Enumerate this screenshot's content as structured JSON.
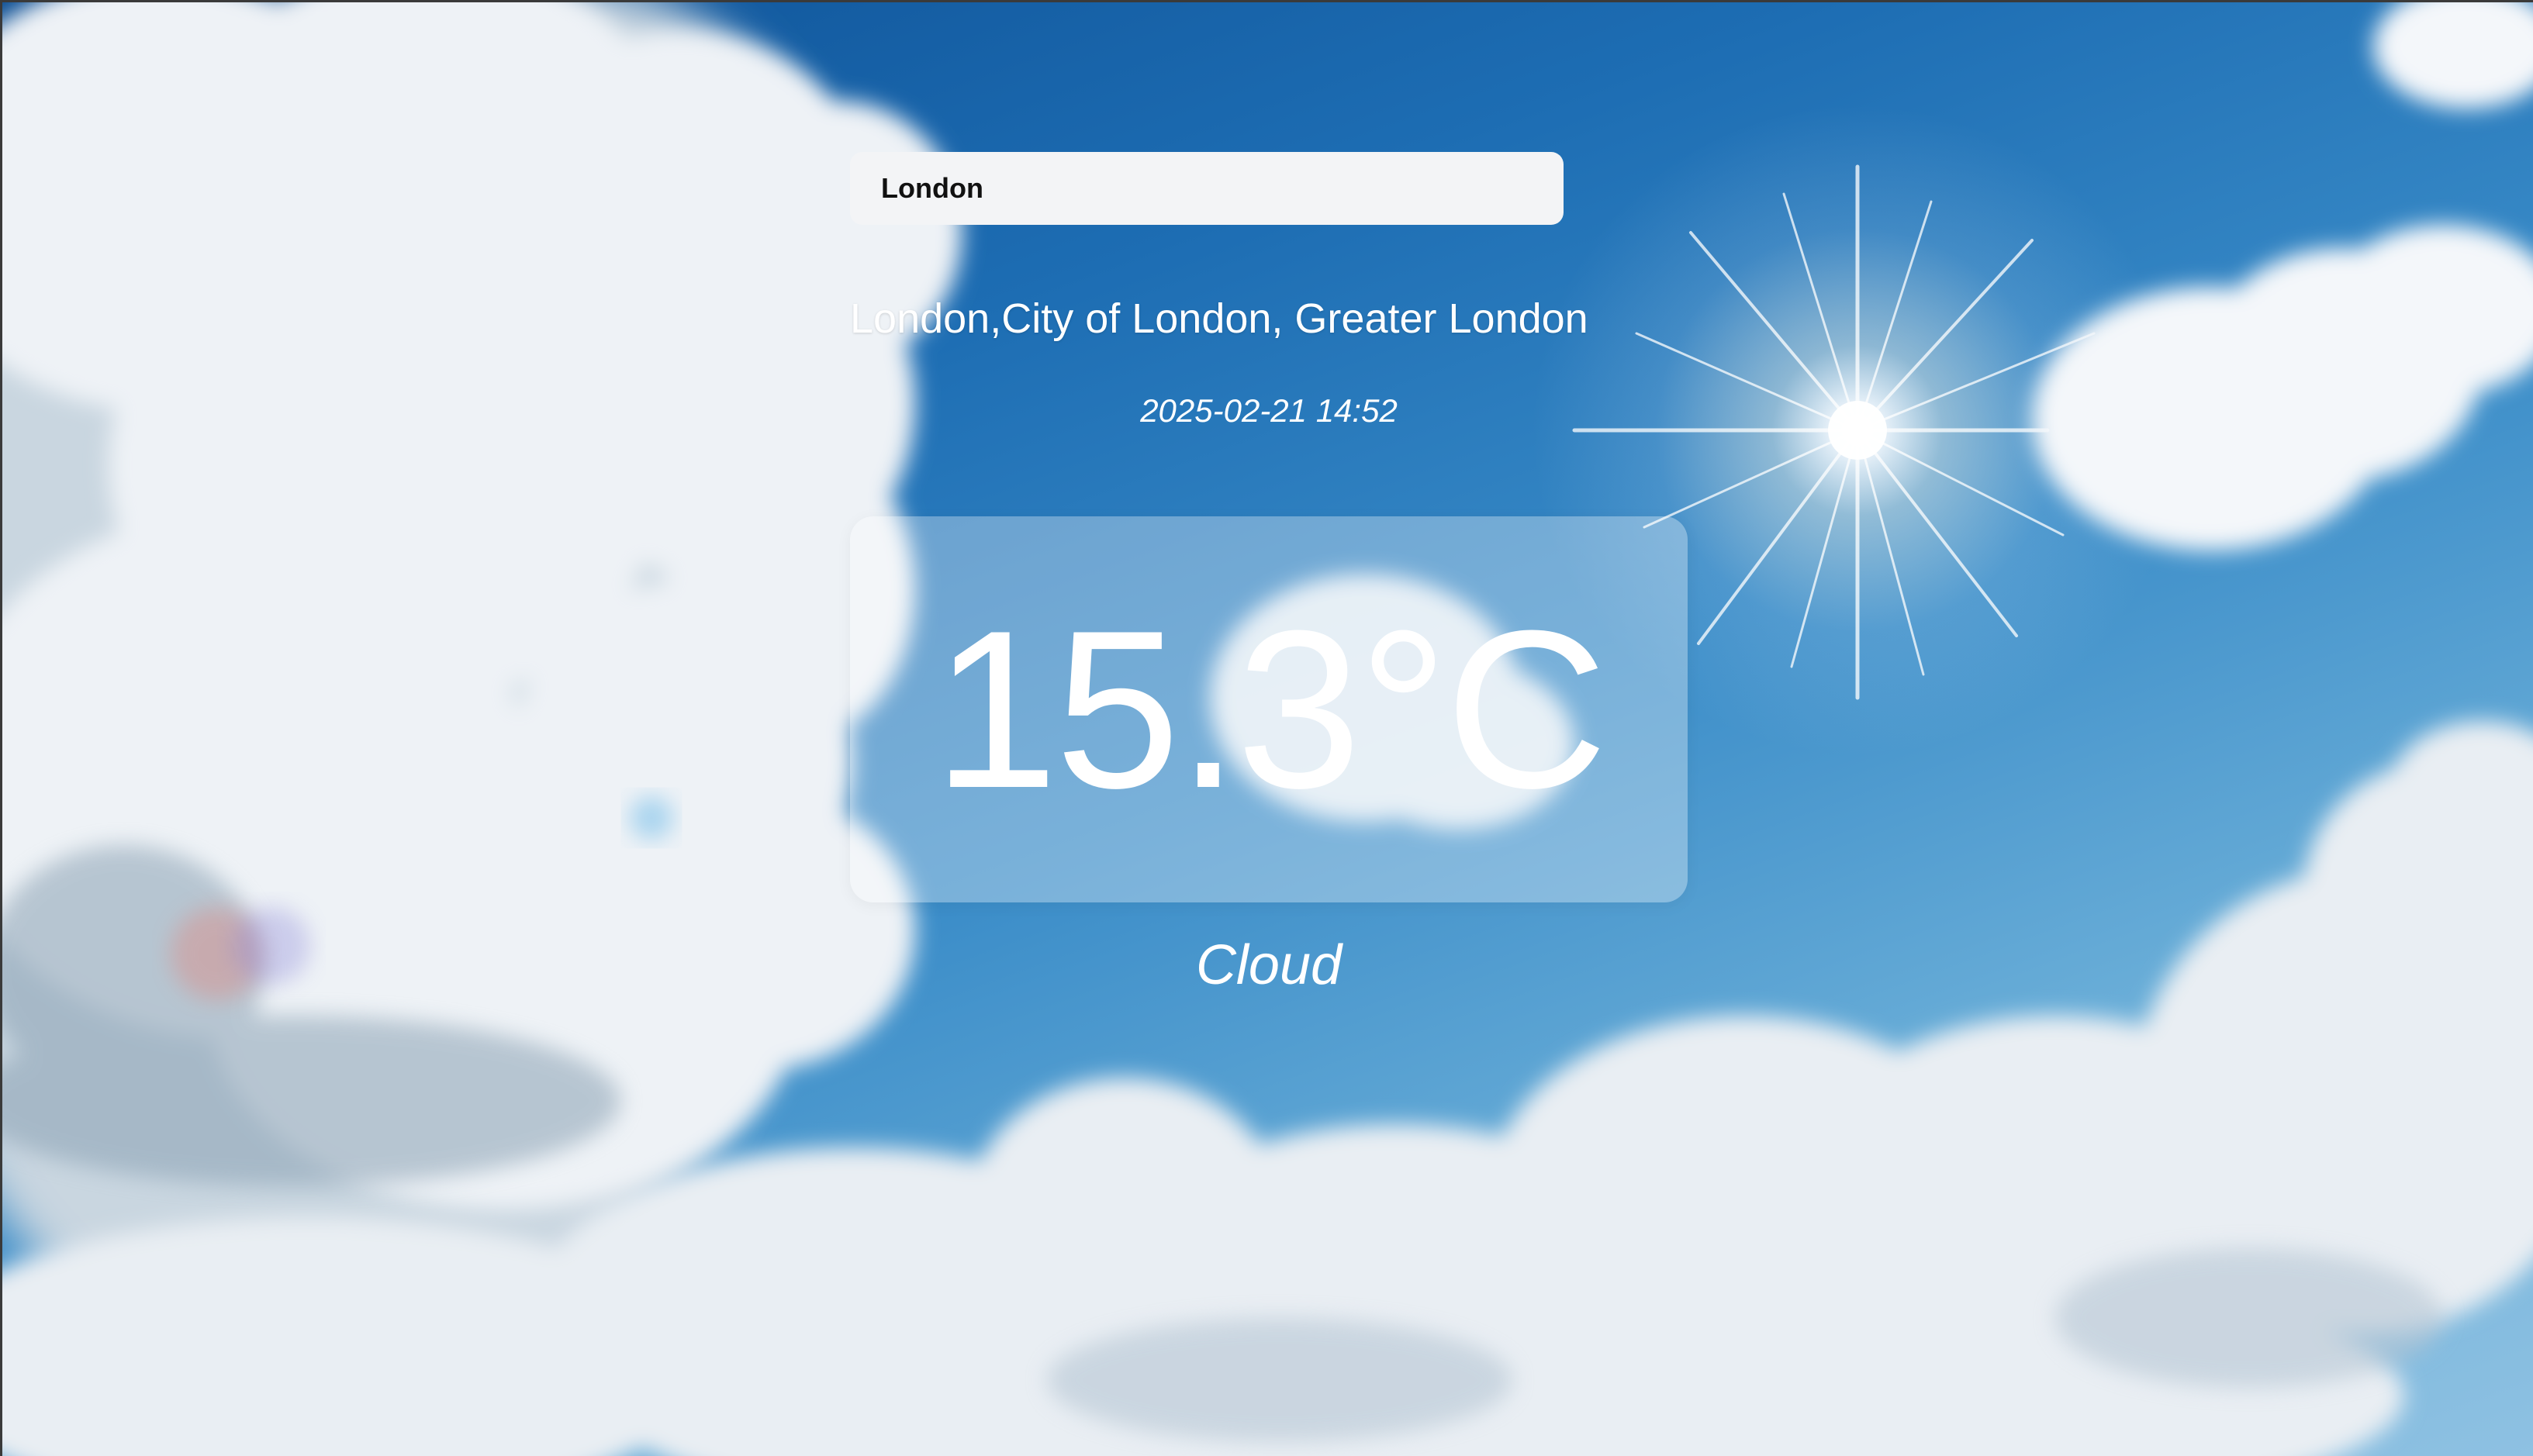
{
  "search": {
    "value": "London",
    "placeholder": ""
  },
  "location": {
    "name": "London,City of London, Greater London"
  },
  "datetime": "2025-02-21 14:52",
  "weather": {
    "temperature": "15.3°C",
    "condition": "Cloud"
  },
  "background": {
    "theme": "sunny-cloudy-sky",
    "sky_color": "#1d6db3",
    "cloud_color": "#f4f7fa",
    "sun_color": "#ffffff"
  }
}
